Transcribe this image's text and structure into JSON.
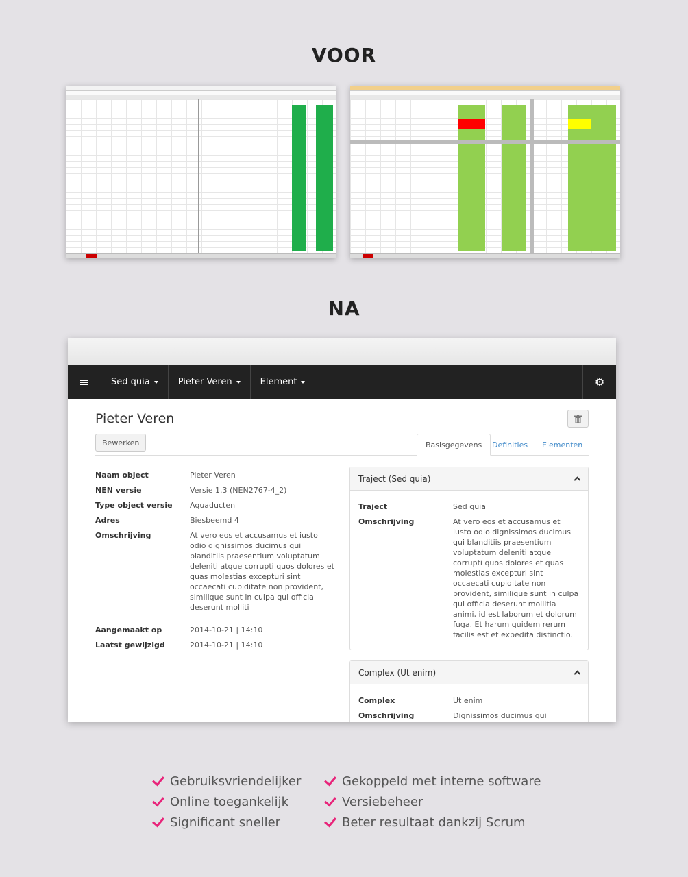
{
  "headings": {
    "before": "VOOR",
    "after": "NA"
  },
  "navbar": {
    "menu1": "Sed quia",
    "menu2": "Pieter Veren",
    "menu3": "Element"
  },
  "page": {
    "title": "Pieter Veren",
    "edit_label": "Bewerken",
    "tabs": [
      "Basisgegevens",
      "Definities",
      "Elementen"
    ]
  },
  "details": [
    {
      "label": "Naam object",
      "value": "Pieter Veren"
    },
    {
      "label": "NEN versie",
      "value": "Versie 1.3 (NEN2767-4_2)"
    },
    {
      "label": "Type object versie",
      "value": "Aquaducten"
    },
    {
      "label": "Adres",
      "value": "Biesbeemd 4"
    },
    {
      "label": "Omschrijving",
      "value": "At vero eos et accusamus et iusto odio dignissimos ducimus qui blanditiis praesentium voluptatum deleniti atque corrupti quos dolores et quas molestias excepturi sint occaecati cupiditate non provident, similique sunt in culpa qui officia deserunt molliti"
    }
  ],
  "meta": [
    {
      "label": "Aangemaakt op",
      "value": "2014-10-21 | 14:10"
    },
    {
      "label": "Laatst gewijzigd",
      "value": "2014-10-21 | 14:10"
    }
  ],
  "panel_traject": {
    "title": "Traject (Sed quia)",
    "rows": [
      {
        "label": "Traject",
        "value": "Sed quia"
      },
      {
        "label": "Omschrijving",
        "value": "At vero eos et accusamus et iusto odio dignissimos ducimus qui blanditiis praesentium voluptatum deleniti atque corrupti quos dolores et quas molestias excepturi sint occaecati cupiditate non provident, similique sunt in culpa qui officia deserunt mollitia animi, id est laborum et dolorum fuga. Et harum quidem rerum facilis est et expedita distinctio."
      }
    ]
  },
  "panel_complex": {
    "title": "Complex (Ut enim)",
    "rows": [
      {
        "label": "Complex",
        "value": "Ut enim"
      },
      {
        "label": "Omschrijving",
        "value": "Dignissimos ducimus qui blanditiis"
      }
    ]
  },
  "features": [
    "Gebruiksvriendelijker",
    "Online toegankelijk",
    "Significant sneller",
    "Gekoppeld met interne software",
    "Versiebeheer",
    "Beter resultaat dankzij Scrum"
  ],
  "colors": {
    "accent": "#e8247a",
    "navbar": "#222222",
    "sheet_green": "#1fae4b",
    "sheet_lightgreen": "#92d050",
    "sheet_red": "#ff0000",
    "sheet_yellow": "#ffff00"
  }
}
